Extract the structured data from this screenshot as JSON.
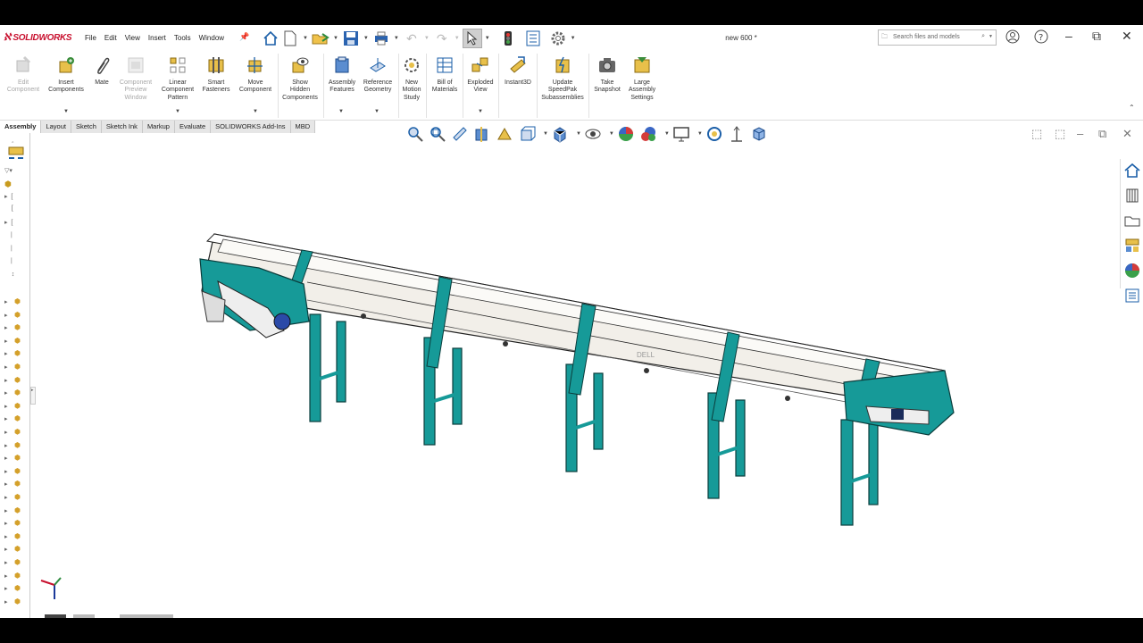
{
  "app": {
    "logo_text": "SOLIDWORKS",
    "document_title": "new 600 *"
  },
  "menu": [
    "File",
    "Edit",
    "View",
    "Insert",
    "Tools",
    "Window"
  ],
  "search": {
    "placeholder": "Search files and models"
  },
  "ribbon": {
    "buttons": [
      {
        "label": "Edit\nComponent",
        "enabled": false
      },
      {
        "label": "Insert\nComponents",
        "enabled": true
      },
      {
        "label": "Mate",
        "enabled": true
      },
      {
        "label": "Component\nPreview\nWindow",
        "enabled": false
      },
      {
        "label": "Linear\nComponent\nPattern",
        "enabled": true
      },
      {
        "label": "Smart\nFasteners",
        "enabled": true
      },
      {
        "label": "Move\nComponent",
        "enabled": true
      },
      {
        "label": "Show\nHidden\nComponents",
        "enabled": true
      },
      {
        "label": "Assembly\nFeatures",
        "enabled": true
      },
      {
        "label": "Reference\nGeometry",
        "enabled": true
      },
      {
        "label": "New\nMotion\nStudy",
        "enabled": true
      },
      {
        "label": "Bill of\nMaterials",
        "enabled": true
      },
      {
        "label": "Exploded\nView",
        "enabled": true
      },
      {
        "label": "Instant3D",
        "enabled": true
      },
      {
        "label": "Update\nSpeedPak\nSubassemblies",
        "enabled": true
      },
      {
        "label": "Take\nSnapshot",
        "enabled": true
      },
      {
        "label": "Large\nAssembly\nSettings",
        "enabled": true
      }
    ]
  },
  "tabs": [
    "Assembly",
    "Layout",
    "Sketch",
    "Sketch Ink",
    "Markup",
    "Evaluate",
    "SOLIDWORKS Add-Ins",
    "MBD"
  ],
  "viewport": {
    "watermark": "DELL"
  },
  "colors": {
    "accent": "#c8102e",
    "frame": "#169a98",
    "panel": "#f2efe9"
  }
}
